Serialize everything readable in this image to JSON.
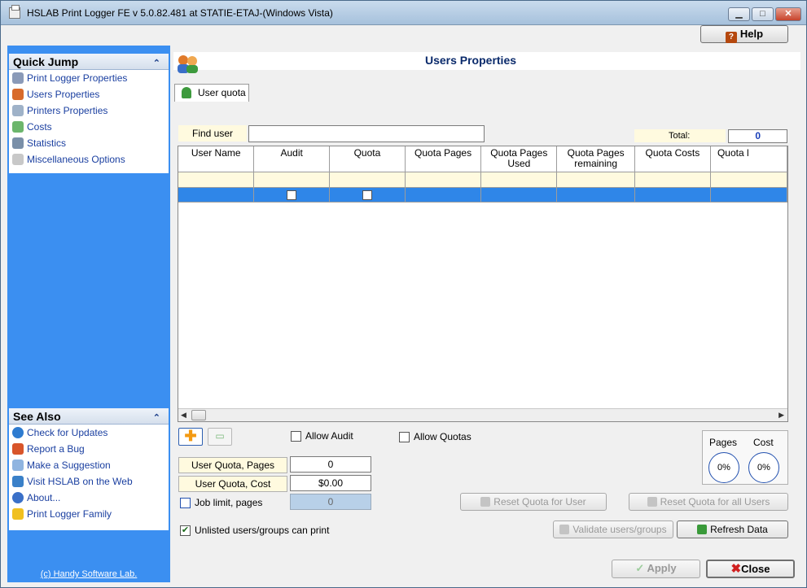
{
  "window": {
    "title": "HSLAB Print Logger FE v 5.0.82.481 at STATIE-ETAJ-(Windows Vista)"
  },
  "toolbar": {
    "help_label": "Help"
  },
  "quick_jump": {
    "title": "Quick Jump",
    "items": [
      {
        "label": "Print Logger Properties",
        "icon": "tools-icon"
      },
      {
        "label": "Users Properties",
        "icon": "users-icon"
      },
      {
        "label": "Printers Properties",
        "icon": "printer-icon"
      },
      {
        "label": "Costs",
        "icon": "money-icon"
      },
      {
        "label": "Statistics",
        "icon": "statistics-icon"
      },
      {
        "label": "Miscellaneous Options",
        "icon": "document-icon"
      }
    ]
  },
  "see_also": {
    "title": "See Also",
    "items": [
      {
        "label": "Check for Updates",
        "icon": "globe-icon"
      },
      {
        "label": "Report a Bug",
        "icon": "bug-icon"
      },
      {
        "label": "Make a Suggestion",
        "icon": "mail-icon"
      },
      {
        "label": "Visit HSLAB on the Web",
        "icon": "web-icon"
      },
      {
        "label": "About...",
        "icon": "info-icon"
      },
      {
        "label": "Print Logger Family",
        "icon": "warning-icon"
      }
    ]
  },
  "copyright": "(c) Handy Software Lab.",
  "main": {
    "title": "Users Properties",
    "tab_label": "User quota",
    "find_label": "Find user",
    "find_value": "",
    "total_label": "Total:",
    "total_value": "0",
    "columns": [
      "User Name",
      "Audit",
      "Quota",
      "Quota Pages",
      "Quota Pages Used",
      "Quota Pages remaining",
      "Quota Costs",
      "Quota l"
    ],
    "allow_audit_label": "Allow Audit",
    "allow_quotas_label": "Allow Quotas",
    "user_quota_pages_label": "User Quota, Pages",
    "user_quota_pages_value": "0",
    "user_quota_cost_label": "User Quota, Cost",
    "user_quota_cost_value": "$0.00",
    "job_limit_label": "Job limit, pages",
    "job_limit_value": "0",
    "unlisted_label": "Unlisted users/groups can print",
    "unlisted_checked": true,
    "pages_label": "Pages",
    "cost_label": "Cost",
    "pages_percent": "0%",
    "cost_percent": "0%",
    "reset_user_label": "Reset Quota for User",
    "reset_all_label": "Reset Quota for all Users",
    "validate_label": "Validate users/groups",
    "refresh_label": "Refresh Data",
    "apply_label": "Apply",
    "close_label": "Close"
  },
  "colors": {
    "sidebar_bg": "#3b8ff1",
    "selection": "#2f86e8",
    "filter_row": "#fffadf",
    "link": "#1a3fa0"
  }
}
